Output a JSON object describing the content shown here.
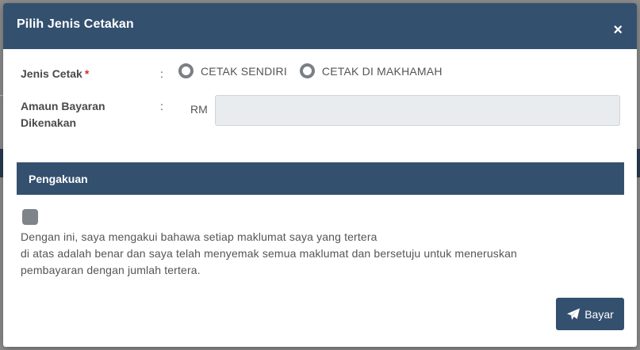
{
  "modal": {
    "title": "Pilih Jenis Cetakan",
    "close_glyph": "×",
    "close_icon": "close-icon"
  },
  "form": {
    "print_type": {
      "label": "Jenis Cetak",
      "required_mark": "*",
      "colon": ":",
      "options": [
        {
          "label": "CETAK SENDIRI",
          "selected": false
        },
        {
          "label": "CETAK DI MAKHAMAH",
          "selected": false
        }
      ]
    },
    "amount": {
      "label_line1": "Amaun Bayaran",
      "label_line2": "Dikenakan",
      "colon": ":",
      "currency": "RM",
      "value": "",
      "placeholder": ""
    }
  },
  "acknowledgement": {
    "section_title": "Pengakuan",
    "checked": false,
    "line1": "Dengan ini, saya mengakui bahawa setiap maklumat saya yang tertera",
    "line2": "di atas adalah benar dan saya telah menyemak semua maklumat dan bersetuju untuk meneruskan",
    "line3": "pembayaran dengan jumlah tertera."
  },
  "actions": {
    "pay_label": "Bayar",
    "pay_icon": "paper-plane-icon"
  },
  "colors": {
    "header": "#34506f",
    "required": "#d32f2f",
    "input_bg": "#e9ecef",
    "radio_border": "#7a7f85"
  }
}
